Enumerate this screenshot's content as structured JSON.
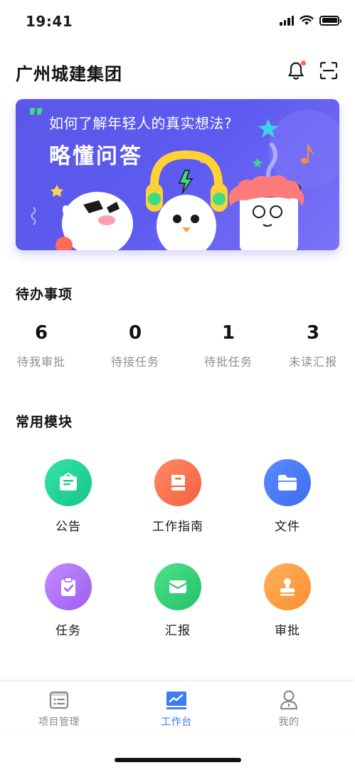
{
  "status_bar": {
    "time": "19:41"
  },
  "header": {
    "title": "广州城建集团"
  },
  "banner": {
    "title": "如何了解年轻人的真实想法?",
    "subtitle": "略懂问答"
  },
  "todo": {
    "title": "待办事项",
    "items": [
      {
        "count": "6",
        "label": "待我审批"
      },
      {
        "count": "0",
        "label": "待接任务"
      },
      {
        "count": "1",
        "label": "待批任务"
      },
      {
        "count": "3",
        "label": "未读汇报"
      }
    ]
  },
  "modules": {
    "title": "常用模块",
    "items": [
      {
        "label": "公告",
        "icon": "notice-board-icon",
        "color_from": "#34e3a6",
        "color_to": "#17c58a"
      },
      {
        "label": "工作指南",
        "icon": "book-icon",
        "color_from": "#ff8a65",
        "color_to": "#f4603f"
      },
      {
        "label": "文件",
        "icon": "folder-icon",
        "color_from": "#5b8cff",
        "color_to": "#3a6cf0"
      },
      {
        "label": "任务",
        "icon": "clipboard-check-icon",
        "color_from": "#c58bff",
        "color_to": "#9c5ef0"
      },
      {
        "label": "汇报",
        "icon": "envelope-icon",
        "color_from": "#4fe08a",
        "color_to": "#22c167"
      },
      {
        "label": "审批",
        "icon": "stamp-icon",
        "color_from": "#ffb15e",
        "color_to": "#fb8f2d"
      }
    ]
  },
  "tabbar": {
    "items": [
      {
        "label": "项目管理",
        "icon": "list-document-icon",
        "active": false
      },
      {
        "label": "工作台",
        "icon": "dashboard-chart-icon",
        "active": true
      },
      {
        "label": "我的",
        "icon": "user-profile-icon",
        "active": false
      }
    ]
  },
  "colors": {
    "accent": "#3e7bf5",
    "banner_bg": "#5b57e8",
    "notification_dot": "#ff6a3d",
    "muted_text": "#8e8e93"
  }
}
